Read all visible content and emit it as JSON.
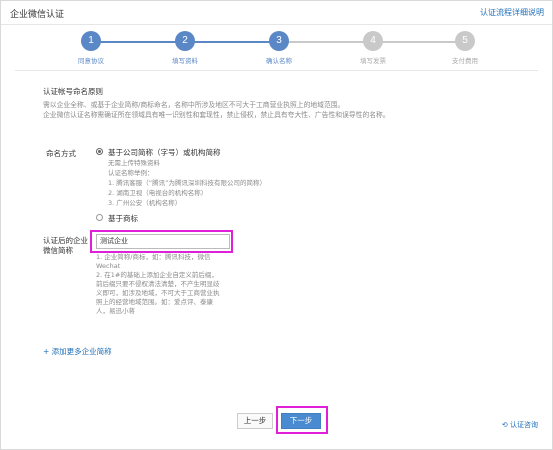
{
  "header": {
    "title": "企业微信认证",
    "help_link": "认证流程详细说明"
  },
  "steps": [
    {
      "num": "1",
      "label": "同意协议",
      "state": "done"
    },
    {
      "num": "2",
      "label": "填写资料",
      "state": "done"
    },
    {
      "num": "3",
      "label": "确认名称",
      "state": "done"
    },
    {
      "num": "4",
      "label": "填写发票",
      "state": "todo"
    },
    {
      "num": "5",
      "label": "支付费用",
      "state": "todo"
    }
  ],
  "rules": {
    "heading": "认证帐号命名原则",
    "line1": "需以企业全称、或基于企业简称/商标命名，名称中所涉及地区不可大于工商营业执照上的地域范围。",
    "line2": "企业微信认证名称需确证所在领域具有唯一识别性和套现性，禁止侵权，禁止具有夸大性、广告性和误导性的名称。"
  },
  "naming": {
    "label": "命名方式",
    "option1": {
      "title": "基于公司简称（字号）或机构简称",
      "lines": [
        "无需上传特殊资料",
        "认证名称举例：",
        "1. 腾讯客服（“腾讯”为腾讯深圳科技有限公司的简称）",
        "2. 湖南卫视（电视台的机构名称）",
        "3. 广州公安（机构名称）"
      ]
    },
    "option2": {
      "title": "基于商标"
    }
  },
  "short_name": {
    "label_line1": "认证后的企业",
    "label_line2": "微信简称",
    "value": "测试企业",
    "hints": [
      "1. 企业简称/商标，如：腾讯科技，微信",
      "Wechat",
      "2. 在1#的基础上添加企业自定义前后缀，",
      "前后缀只要不侵权清法清楚，不产生明显歧",
      "义即可，如涉及地域，不可大于工商营业执",
      "照上的经营地域范围。如：爱点评、泰康",
      "人，易迅小蒋"
    ]
  },
  "add_more": "+ 添加更多企业简称",
  "buttons": {
    "prev": "上一步",
    "next": "下一步"
  },
  "consult": "认证咨询",
  "colors": {
    "accent": "#5a87c5",
    "link": "#1f6fb8",
    "highlight": "#e020d8",
    "primary_button": "#4a8ad0"
  }
}
